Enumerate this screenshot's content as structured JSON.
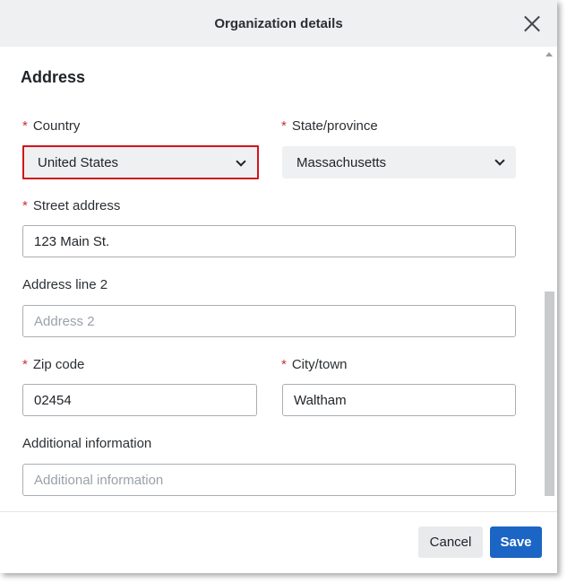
{
  "dialog": {
    "title": "Organization details",
    "section_title": "Address"
  },
  "form": {
    "required_marker": "*",
    "country": {
      "label": "Country",
      "value": "United States"
    },
    "state": {
      "label": "State/province",
      "value": "Massachusetts"
    },
    "street": {
      "label": "Street address",
      "value": "123 Main St."
    },
    "address2": {
      "label": "Address line 2",
      "value": "",
      "placeholder": "Address 2"
    },
    "zip": {
      "label": "Zip code",
      "value": "02454"
    },
    "city": {
      "label": "City/town",
      "value": "Waltham"
    },
    "additional": {
      "label": "Additional information",
      "value": "",
      "placeholder": "Additional information"
    }
  },
  "footer": {
    "cancel_label": "Cancel",
    "save_label": "Save"
  },
  "colors": {
    "primary": "#1b65c4",
    "required": "#c8323b",
    "highlight": "#d2141c"
  },
  "icons": {
    "close": "close-icon",
    "chevron": "chevron-down-icon"
  }
}
